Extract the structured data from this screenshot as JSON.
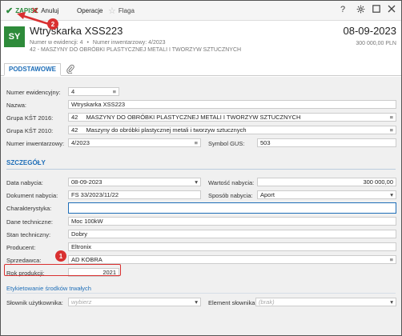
{
  "toolbar": {
    "save_label": "ZAPISZ",
    "cancel_label": "Anuluj",
    "operations_label": "Operacje",
    "flag_label": "Flaga",
    "help_symbol": "?",
    "settings_icon": "gear-icon",
    "maximize_icon": "maximize-icon",
    "close_icon": "close-icon"
  },
  "header": {
    "avatar": "SY",
    "title": "Wtryskarka XSS223",
    "date": "08-09-2023",
    "evidence_number": "Numer w ewidencji: 4",
    "inventory_number": "Numer inwentarzowy: 4/2023",
    "category": "42 - MASZYNY DO OBRÓBKI PLASTYCZNEJ METALI I TWORZYW SZTUCZNYCH",
    "amount": "300 000,00 PLN"
  },
  "tabs": {
    "basic_label": "PODSTAWOWE",
    "attachments_icon": "paperclip-icon"
  },
  "basic": {
    "evidence_number_label": "Numer ewidencyjny:",
    "evidence_number_value": "4",
    "name_label": "Nazwa:",
    "name_value": "Wtryskarka XSS223",
    "kst2016_label": "Grupa KŚT 2016:",
    "kst2016_code": "42",
    "kst2016_value": "MASZYNY DO OBRÓBKI PLASTYCZNEJ METALI I TWORZYW SZTUCZNYCH",
    "kst2010_label": "Grupa KŚT 2010:",
    "kst2010_code": "42",
    "kst2010_value": "Maszyny do obróbki plastycznej metali i tworzyw sztucznych",
    "inventory_label": "Numer inwentarzowy:",
    "inventory_value": "4/2023",
    "gus_label": "Symbol GUS:",
    "gus_value": "503"
  },
  "details": {
    "section_title": "SZCZEGÓŁY",
    "purchase_date_label": "Data nabycia:",
    "purchase_date_value": "08-09-2023",
    "purchase_value_label": "Wartość nabycia:",
    "purchase_value_value": "300 000,00",
    "document_label": "Dokument nabycia:",
    "document_value": "FS 33/2023/11/22",
    "method_label": "Sposób nabycia:",
    "method_value": "Aport",
    "characteristic_label": "Charakterystyka:",
    "characteristic_value": "",
    "tech_data_label": "Dane techniczne:",
    "tech_data_value": "Moc 100kW",
    "tech_state_label": "Stan techniczny:",
    "tech_state_value": "Dobry",
    "producer_label": "Producent:",
    "producer_value": "Eltronix",
    "seller_label": "Sprzedawca:",
    "seller_value": "AD KOBRA",
    "year_label": "Rok produkcji:",
    "year_value": "2021"
  },
  "labels_section": {
    "title": "Etykietowanie środków trwałych",
    "dictionary_label": "Słownik użytkownika:",
    "dictionary_placeholder": "wybierz",
    "element_label": "Element słownika:",
    "element_placeholder": "(brak)"
  },
  "annotations": {
    "badge1": "1",
    "badge2": "2",
    "color": "#d93030"
  },
  "colors": {
    "accent": "#1e6eb8",
    "save_green": "#2c8a3d",
    "avatar_green": "#2e8b3a",
    "cancel_red": "#c0282e"
  }
}
